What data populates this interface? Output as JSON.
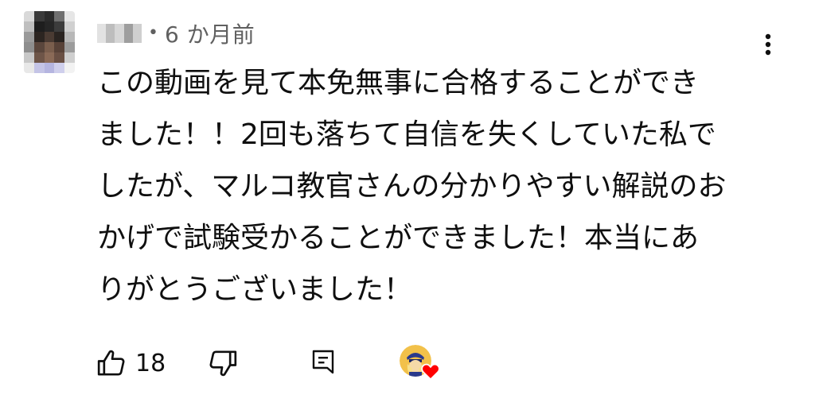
{
  "comment": {
    "author_avatar": {
      "icon": "pixelated-avatar-icon",
      "pixels": [
        "#d9d9d9",
        "#3a3a3a",
        "#2b2b2b",
        "#6f6f6f",
        "#e6e6e6",
        "#bfbfbf",
        "#1e1e1e",
        "#262626",
        "#3c3c3c",
        "#d0d0d0",
        "#9a9a9a",
        "#2c2521",
        "#4a3b33",
        "#2a2421",
        "#b8b8b8",
        "#8e8e8e",
        "#5a463c",
        "#7a5e4d",
        "#584238",
        "#9c9c9c",
        "#c8c8c8",
        "#6e5548",
        "#8a6a57",
        "#6a5044",
        "#cfcfcf",
        "#e8e8e8",
        "#c4c4e6",
        "#b5b5e0",
        "#cfcfec",
        "#f2f2f2"
      ]
    },
    "author_name_blur": {
      "icon": "blurred-username-icon",
      "pixels": [
        "#e2e2e2",
        "#bdbdbd",
        "#d6d6d6",
        "#9e9e9e",
        "#cfcfcf"
      ]
    },
    "separator": "•",
    "timestamp": "6 か月前",
    "menu_icon": "more-vert-icon",
    "text_lines": [
      "この動画を見て本免無事に合格することができ",
      "ました！！2回も落ちて自信を失くしていた私で",
      "したが、マルコ教官さんの分かりやすい解説のお",
      "かげで試験受かることができました！本当にあ",
      "りがとうございました！"
    ],
    "actions": {
      "like_icon": "thumb-up-icon",
      "like_count": "18",
      "dislike_icon": "thumb-down-icon",
      "reply_icon": "reply-comment-icon",
      "creator_heart_icon": "creator-heart-icon"
    },
    "colors": {
      "text_primary": "#0f0f0f",
      "text_secondary": "#606060",
      "heart_red": "#ff0000",
      "creator_avatar_bg": "#f2c14a"
    }
  }
}
